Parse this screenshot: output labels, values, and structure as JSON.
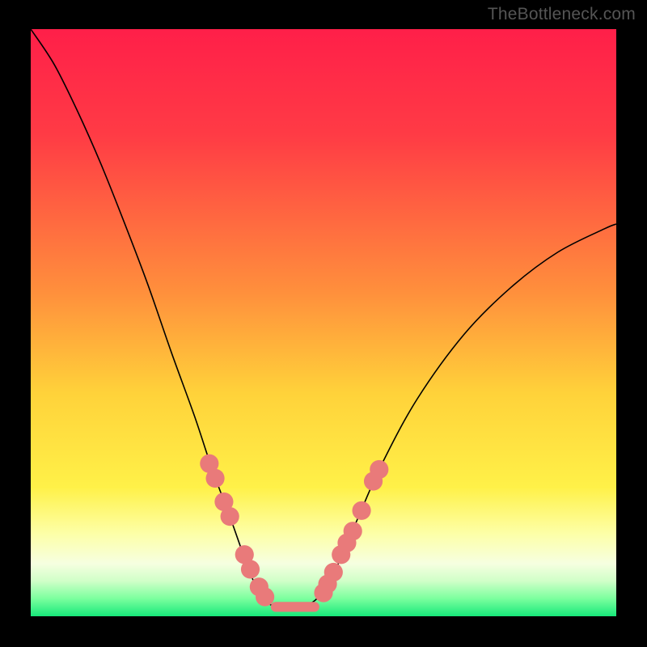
{
  "watermark": "TheBottleneck.com",
  "chart_data": {
    "type": "line",
    "title": "",
    "xlabel": "",
    "ylabel": "",
    "xlim": [
      0,
      100
    ],
    "ylim": [
      0,
      100
    ],
    "background_gradient": {
      "stops": [
        {
          "offset": 0,
          "color": "#ff1f49"
        },
        {
          "offset": 18,
          "color": "#ff3b45"
        },
        {
          "offset": 45,
          "color": "#ff903c"
        },
        {
          "offset": 62,
          "color": "#ffd23a"
        },
        {
          "offset": 78,
          "color": "#fff148"
        },
        {
          "offset": 86,
          "color": "#fdffa8"
        },
        {
          "offset": 91,
          "color": "#f6ffe0"
        },
        {
          "offset": 94,
          "color": "#d0ffc8"
        },
        {
          "offset": 97,
          "color": "#7bff9e"
        },
        {
          "offset": 100,
          "color": "#17e87a"
        }
      ]
    },
    "series": [
      {
        "name": "bottleneck-curve",
        "color": "#000000",
        "x": [
          0,
          4,
          8,
          12,
          16,
          20,
          24,
          28,
          31,
          34,
          36.5,
          38.5,
          40.5,
          42.5,
          45,
          48,
          50.5,
          53,
          56,
          60,
          66,
          74,
          82,
          90,
          98,
          100
        ],
        "values": [
          100,
          94,
          86,
          77,
          67,
          56.5,
          45,
          34,
          25,
          17,
          10,
          5,
          2.3,
          1.5,
          1.5,
          2.3,
          5,
          10,
          17,
          26,
          37,
          48,
          56,
          62,
          66,
          66.8
        ]
      }
    ],
    "markers": {
      "name": "highlight-dots",
      "color": "#e97a7a",
      "radius": 1.6,
      "points_left": [
        {
          "x": 30.5,
          "y": 26
        },
        {
          "x": 31.5,
          "y": 23.5
        },
        {
          "x": 33,
          "y": 19.5
        },
        {
          "x": 34,
          "y": 17
        },
        {
          "x": 36.5,
          "y": 10.5
        },
        {
          "x": 37.5,
          "y": 8
        },
        {
          "x": 39,
          "y": 5
        },
        {
          "x": 40,
          "y": 3.3
        }
      ],
      "points_right": [
        {
          "x": 50,
          "y": 4
        },
        {
          "x": 50.7,
          "y": 5.5
        },
        {
          "x": 51.7,
          "y": 7.5
        },
        {
          "x": 53,
          "y": 10.5
        },
        {
          "x": 54,
          "y": 12.5
        },
        {
          "x": 55,
          "y": 14.5
        },
        {
          "x": 56.5,
          "y": 18
        },
        {
          "x": 58.5,
          "y": 23
        },
        {
          "x": 59.5,
          "y": 25
        }
      ]
    },
    "trough_band": {
      "color": "#e97a7a",
      "y": 1.6,
      "x_start": 41,
      "x_end": 49.3,
      "thickness": 1.7
    }
  }
}
